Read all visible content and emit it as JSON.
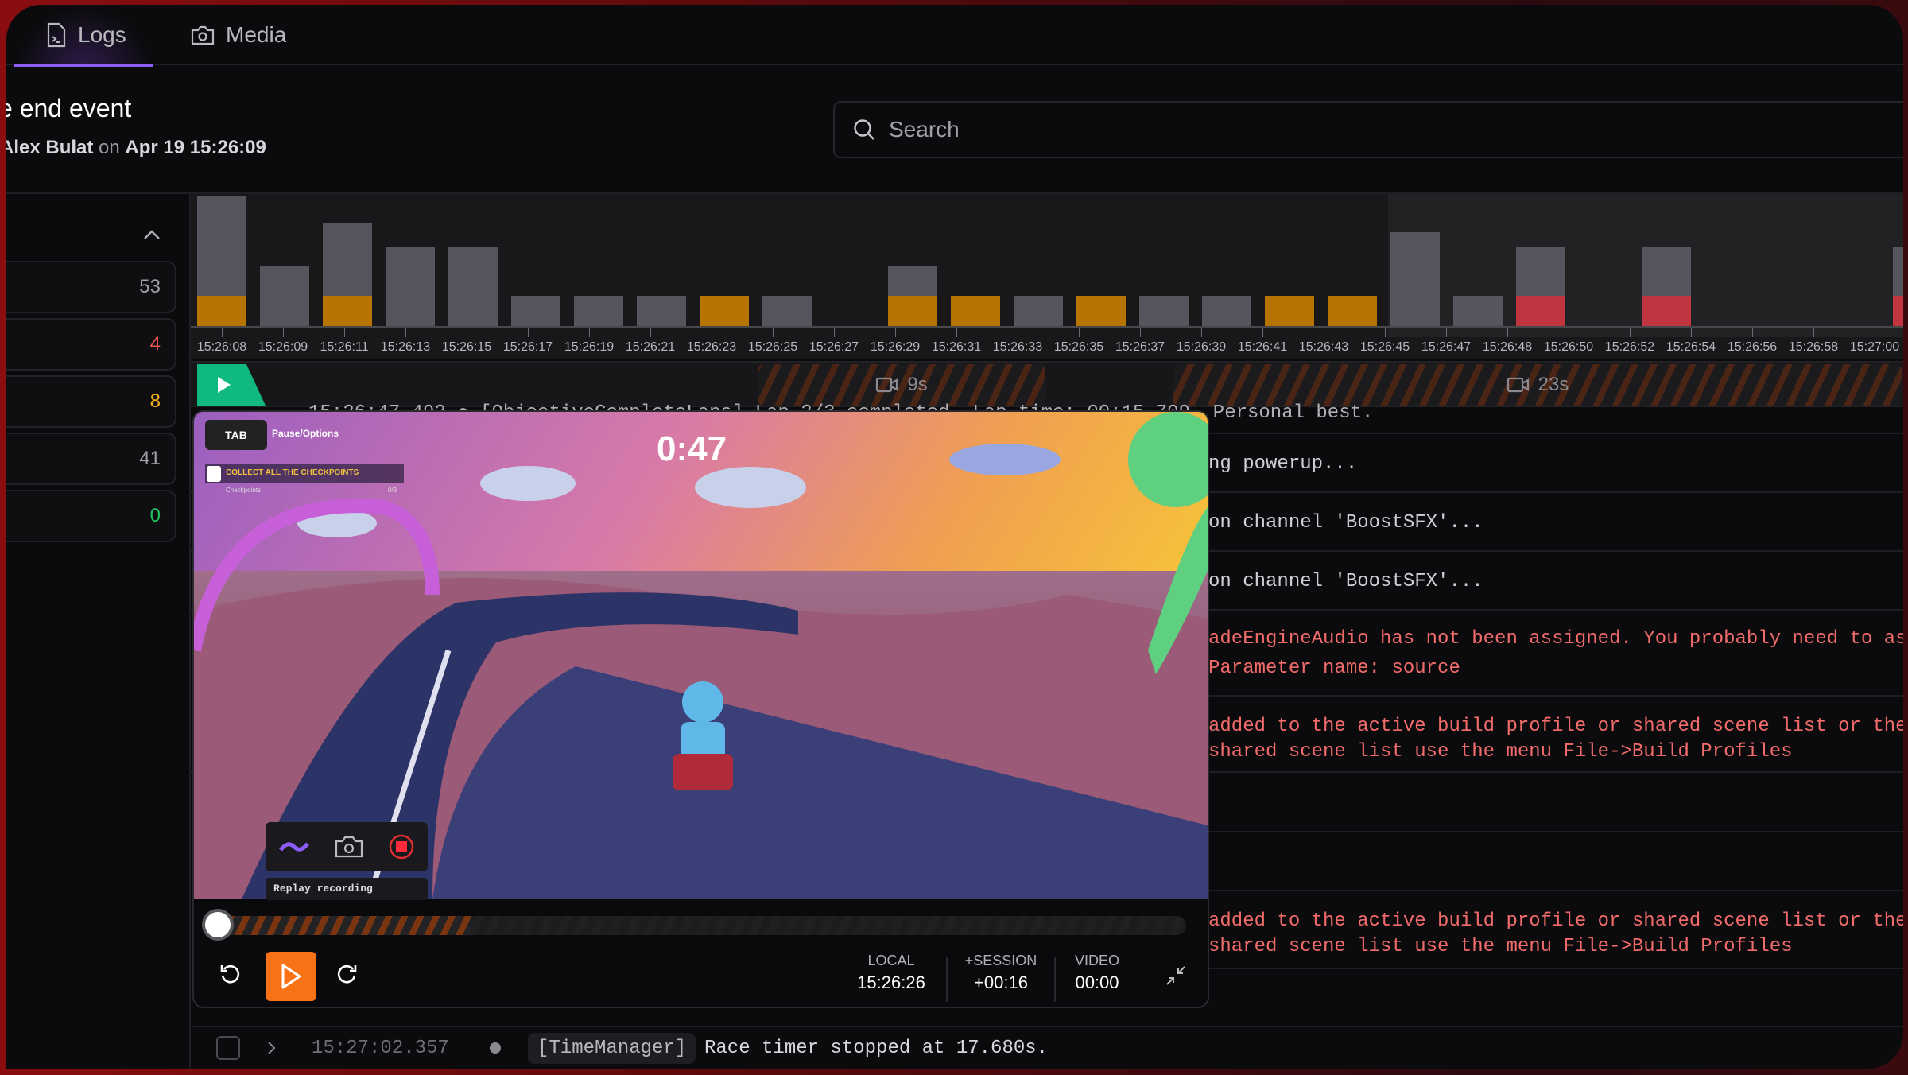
{
  "tabs": [
    {
      "label": "Logs",
      "icon": "terminal-file-icon",
      "active": true
    },
    {
      "label": "Media",
      "icon": "camera-icon",
      "active": false
    }
  ],
  "event": {
    "title": "e end event",
    "author": "Alex Bulat",
    "on": "on",
    "date": "Apr 19 15:26:09"
  },
  "search": {
    "placeholder": "Search",
    "value": ""
  },
  "sidebar": {
    "collapse_icon": "chevron-up-icon",
    "counts": [
      {
        "value": "53",
        "color": "#a0a0a6"
      },
      {
        "value": "4",
        "color": "#f05252"
      },
      {
        "value": "8",
        "color": "#f5b014"
      },
      {
        "value": "41",
        "color": "#a0a0a6"
      },
      {
        "value": "0",
        "color": "#22c55e"
      }
    ]
  },
  "chart_data": {
    "type": "bar",
    "stacked": true,
    "categories": [
      "15:26:08",
      "15:26:09",
      "15:26:11",
      "15:26:13",
      "15:26:15",
      "15:26:17",
      "15:26:19",
      "15:26:21",
      "15:26:23",
      "15:26:25",
      "15:26:27",
      "15:26:29",
      "15:26:31",
      "15:26:33",
      "15:26:35",
      "15:26:37",
      "15:26:39",
      "15:26:41",
      "15:26:43",
      "15:26:45",
      "15:26:47",
      "15:26:48",
      "15:26:50",
      "15:26:52",
      "15:26:54",
      "15:26:56",
      "15:26:58",
      "15:27:00"
    ],
    "series": [
      {
        "values": [
          1,
          0,
          1,
          0,
          0,
          0,
          0,
          0,
          1,
          0,
          0,
          1,
          1,
          0,
          1,
          0,
          0,
          1,
          1,
          0,
          0,
          0,
          0,
          0,
          0,
          0,
          0,
          0
        ],
        "color": "#b87400"
      },
      {
        "values": [
          0,
          0,
          0,
          0,
          0,
          0,
          0,
          0,
          0,
          0,
          0,
          0,
          0,
          0,
          0,
          0,
          0,
          0,
          0,
          0,
          0,
          1,
          0,
          1,
          0,
          0,
          0,
          1
        ],
        "color": "#c0353f"
      },
      {
        "values": [
          3.3,
          2,
          2.4,
          2.6,
          2.6,
          1,
          1,
          1,
          0,
          1,
          0,
          1,
          0,
          1,
          0,
          1,
          1,
          0,
          0,
          3.1,
          1,
          1.6,
          0,
          1.6,
          0,
          0,
          0,
          1.6
        ],
        "color": "#55555d"
      }
    ],
    "grid": false
  },
  "track": {
    "segments": [
      {
        "label": "9s",
        "icon": "video-camera-icon"
      },
      {
        "label": "23s",
        "icon": "video-camera-icon"
      }
    ]
  },
  "logs": [
    {
      "text": "15:26:47.492  ●  [ObjectiveCompleteLaps] Lap 2/3 completed. Lap time: 00:15.709. Personal best.",
      "level": "info"
    },
    {
      "text": "ng powerup...",
      "level": "info"
    },
    {
      "text": "on channel 'BoostSFX'...",
      "level": "info"
    },
    {
      "text": "on channel 'BoostSFX'...",
      "level": "info"
    },
    {
      "text": "adeEngineAudio has not been assigned. You probably need to as",
      "text2": "Parameter name: source",
      "level": "error"
    },
    {
      "text": "added to the active build profile or shared scene list or the",
      "text2": "shared scene list use the menu File->Build Profiles",
      "level": "error"
    },
    {
      "text": "",
      "level": "info"
    },
    {
      "text": "",
      "level": "info"
    },
    {
      "text": "added to the active build profile or shared scene list or the",
      "text2": "shared scene list use the menu File->Build Profiles",
      "level": "error"
    },
    {
      "text": "",
      "level": "info"
    }
  ],
  "last_log": {
    "time": "15:27:02.357",
    "tag": "[TimeManager]",
    "message": "Race timer stopped at 17.680s."
  },
  "video": {
    "hud": {
      "tab_key": "TAB",
      "tab_hint": "Pause/Options",
      "timer": "0:47",
      "objective": "COLLECT ALL THE CHECKPOINTS",
      "objective_sub": "Checkpoints",
      "objective_count": "0/3",
      "replay_label": "Replay recording"
    },
    "progress": 0.27,
    "local_label": "LOCAL",
    "local": "15:26:26",
    "session_label": "+SESSION",
    "session": "+00:16",
    "video_label": "VIDEO",
    "video": "00:00"
  }
}
